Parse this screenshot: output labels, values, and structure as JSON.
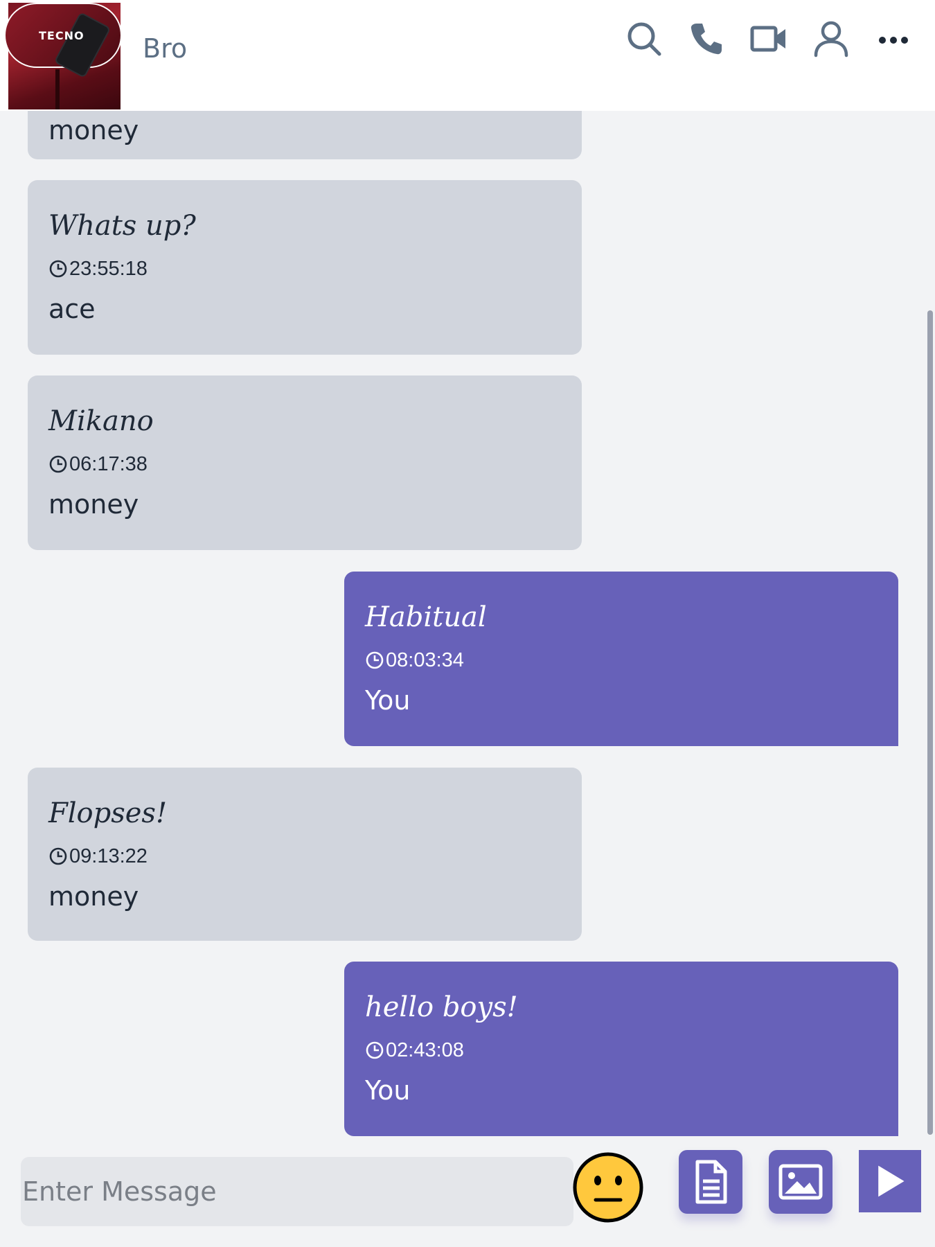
{
  "header": {
    "contact_name": "Bro",
    "avatar_logo_text": "TECNO",
    "icons": [
      "search-icon",
      "phone-icon",
      "video-camera-icon",
      "user-icon",
      "more-icon"
    ]
  },
  "messages": [
    {
      "direction": "incoming",
      "text": "",
      "time": "",
      "sender": "money"
    },
    {
      "direction": "incoming",
      "text": "Whats up?",
      "time": "23:55:18",
      "sender": "ace"
    },
    {
      "direction": "incoming",
      "text": "Mikano",
      "time": "06:17:38",
      "sender": "money"
    },
    {
      "direction": "outgoing",
      "text": "Habitual",
      "time": "08:03:34",
      "sender": "You"
    },
    {
      "direction": "incoming",
      "text": "Flopses!",
      "time": "09:13:22",
      "sender": "money"
    },
    {
      "direction": "outgoing",
      "text": "hello boys!",
      "time": "02:43:08",
      "sender": "You"
    }
  ],
  "composer": {
    "placeholder": "Enter Message",
    "value": ""
  },
  "colors": {
    "accent": "#6761b9",
    "incoming_bubble": "#d1d5dd",
    "background": "#f2f3f5",
    "icon": "#5c6f84"
  }
}
